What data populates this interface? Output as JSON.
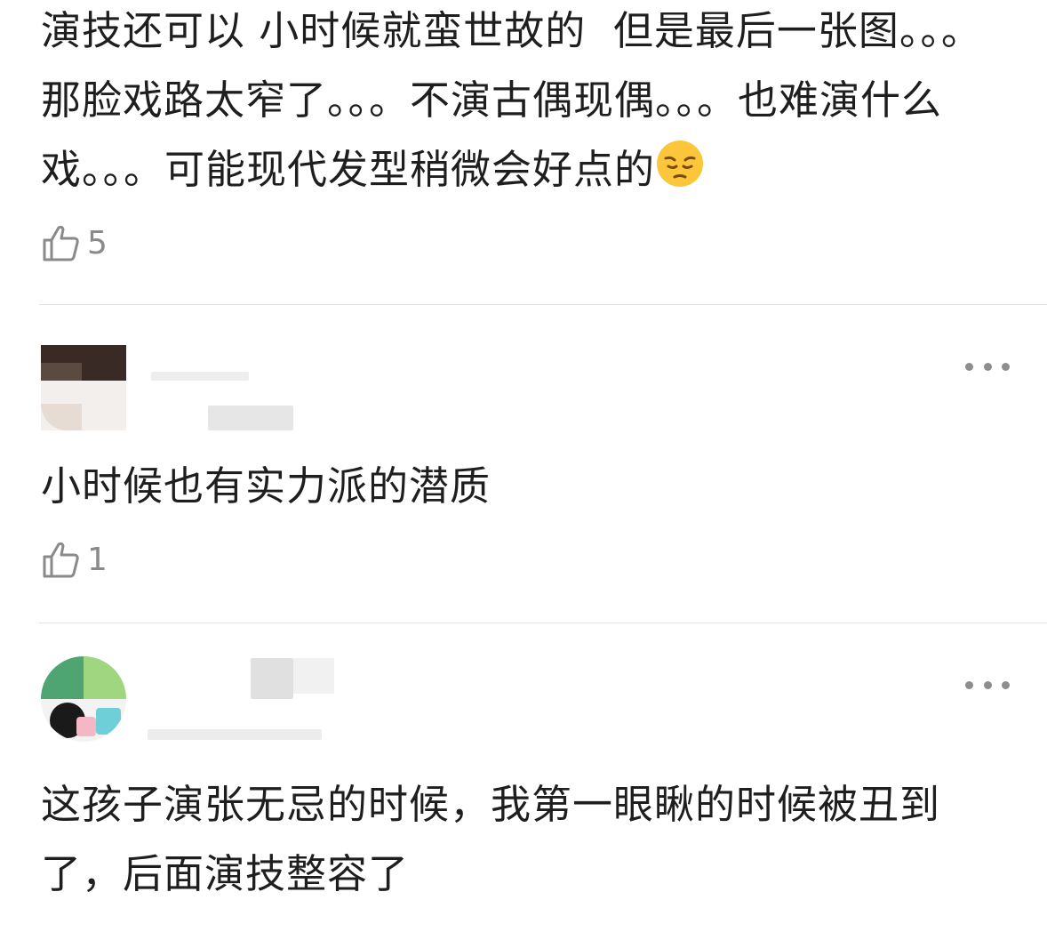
{
  "comments": [
    {
      "text": "演技还可以 小时候就蛮世故的  但是最后一张图。。。那脸戏路太窄了。。。不演古偶现偶。。。也难演什么戏。。。可能现代发型稍微会好点的",
      "emoji": "pensive-face-emoji",
      "likes": "5"
    },
    {
      "text": "小时候也有实力派的潜质",
      "likes": "1"
    },
    {
      "text": "这孩子演张无忌的时候，我第一眼瞅的时候被丑到了，后面演技整容了"
    }
  ],
  "colors": {
    "text": "#1e1e1e",
    "muted": "#8a8a8a",
    "divider": "#e3e3e3"
  }
}
